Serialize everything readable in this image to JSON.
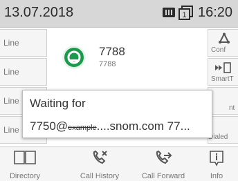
{
  "statusbar": {
    "date": "13.07.2018",
    "time": "16:20",
    "line_indicator": "1"
  },
  "left_keys": [
    "Line",
    "Line",
    "Line",
    "Line"
  ],
  "right_keys": [
    {
      "label": "Conf",
      "icon": "conference-icon"
    },
    {
      "label": "SmartT",
      "icon": "smart-transfer-icon"
    },
    {
      "label": "nt",
      "icon": ""
    },
    {
      "label": "Dialed",
      "icon": ""
    }
  ],
  "call": {
    "number": "7788",
    "subnumber": "7788",
    "avatar_color": "#1b9a4b"
  },
  "popup": {
    "title": "Waiting for",
    "target": "7750@",
    "target_host": "example",
    "target_rest": "....snom.com 77..."
  },
  "bottom_keys": [
    {
      "label": "Directory",
      "icon": "book-icon"
    },
    {
      "label": "Call History",
      "icon": "call-history-icon"
    },
    {
      "label": "Call Forward",
      "icon": "call-forward-icon"
    },
    {
      "label": "Info",
      "icon": "info-icon"
    }
  ]
}
